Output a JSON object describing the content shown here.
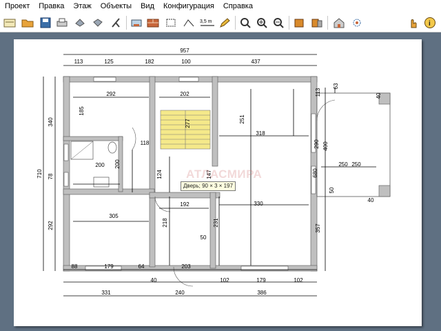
{
  "menu": {
    "items": [
      "Проект",
      "Правка",
      "Этаж",
      "Объекты",
      "Вид",
      "Конфигурация",
      "Справка"
    ]
  },
  "toolbar": {
    "scale_label": "3,5 m",
    "colors": {
      "folder": "#e8a33a",
      "save": "#3a6ea8",
      "brick": "#c8663a",
      "wall3d": "#d98a2b"
    }
  },
  "plan": {
    "dims_top": {
      "total": "957",
      "segments": [
        "113",
        "125",
        "182",
        "100",
        "437"
      ]
    },
    "dims_bottom": {
      "segments_a": [
        "88",
        "179",
        "64",
        "203",
        "50",
        "102",
        "179",
        "102"
      ],
      "small": "40",
      "totals": [
        "331",
        "240",
        "386"
      ]
    },
    "dims_left": {
      "outer": "710",
      "inner": [
        "340",
        "78",
        "292"
      ]
    },
    "dims_right": {
      "top": "63",
      "mid": [
        "113",
        "290",
        "400",
        "50",
        "40"
      ],
      "bottom": "357",
      "porch_w": "40",
      "porch_len": "250"
    },
    "labels": {
      "room_top_left": "292",
      "room_top_left_h": "185",
      "stairs_w": "202",
      "stairs_h": "277",
      "small_118": "118",
      "bath_w": "200",
      "bath_h": "200",
      "hall_124": "124",
      "hall_147": "147",
      "room_big_h": "251",
      "room_big_w": "318",
      "room_big_w2": "330",
      "room_right_h": "680",
      "room_bl_w": "305",
      "room_bl_h": "218",
      "room_mid_w": "192",
      "room_mid_h": "231",
      "room_mid_50": "50",
      "porch_w": "250"
    },
    "watermark": "АТЛАСМИРА",
    "watermark_sub": "недвижимость"
  },
  "tooltip": {
    "text": "Дверь; 90 × 3 × 197"
  }
}
